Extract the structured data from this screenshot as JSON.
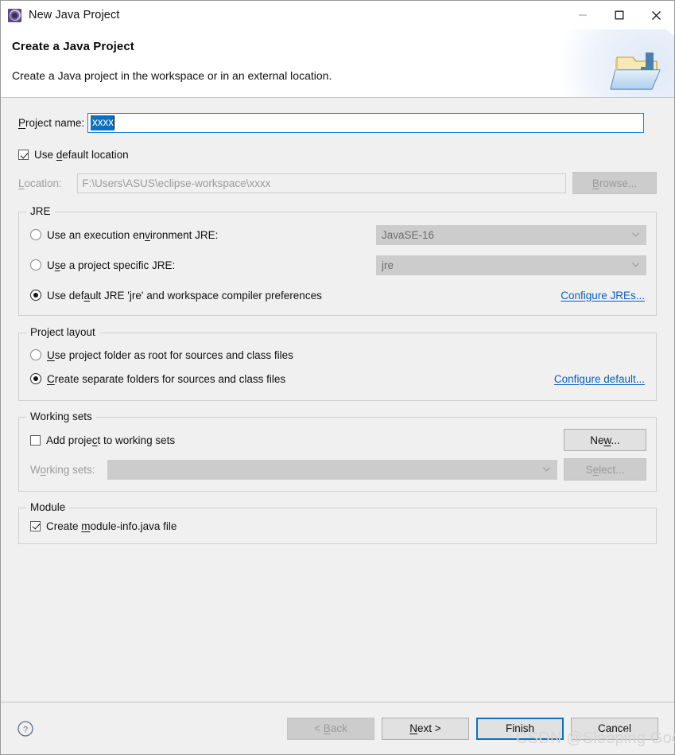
{
  "window": {
    "title": "New Java Project",
    "icon": "java-project-icon",
    "controls": {
      "minimize": "minimize-icon",
      "maximize": "maximize-icon",
      "close": "close-icon"
    }
  },
  "header": {
    "title": "Create a Java Project",
    "description": "Create a Java project in the workspace or in an external location.",
    "banner_icon": "java-project-folder-icon"
  },
  "project": {
    "name_label": "Project name:",
    "name_value": "xxxx",
    "name_selected": true,
    "use_default_location_label": "Use default location",
    "use_default_location_checked": true,
    "location_label": "Location:",
    "location_value": "F:\\Users\\ASUS\\eclipse-workspace\\xxxx",
    "browse_label": "Browse...",
    "browse_enabled": false
  },
  "jre": {
    "legend": "JRE",
    "options": [
      {
        "label_pre": "Use an execution en",
        "label_mn": "v",
        "label_post": "ironment JRE:",
        "selected": false,
        "combo_value": "JavaSE-16",
        "combo_enabled": false
      },
      {
        "label_pre": "U",
        "label_mn": "s",
        "label_post": "e a project specific JRE:",
        "selected": false,
        "combo_value": "jre",
        "combo_enabled": false
      },
      {
        "label_pre": "Use def",
        "label_mn": "a",
        "label_post": "ult JRE 'jre' and workspace compiler preferences",
        "selected": true,
        "combo_value": null,
        "combo_enabled": false
      }
    ],
    "configure_link": "Configure JREs..."
  },
  "layout": {
    "legend": "Project layout",
    "options": [
      {
        "label_pre": "",
        "label_mn": "U",
        "label_post": "se project folder as root for sources and class files",
        "selected": false
      },
      {
        "label_pre": "",
        "label_mn": "C",
        "label_post": "reate separate folders for sources and class files",
        "selected": true
      }
    ],
    "configure_link": "Configure default..."
  },
  "working_sets": {
    "legend": "Working sets",
    "add_label_pre": "Add proje",
    "add_label_mn": "c",
    "add_label_post": "t to working sets",
    "add_checked": false,
    "sets_label_pre": "W",
    "sets_label_mn": "o",
    "sets_label_post": "rking sets:",
    "sets_value": "",
    "sets_enabled": false,
    "new_label_pre": "Ne",
    "new_label_mn": "w",
    "new_label_post": "...",
    "new_enabled": true,
    "select_label_pre": "S",
    "select_label_mn": "e",
    "select_label_post": "lect...",
    "select_enabled": false
  },
  "module": {
    "legend": "Module",
    "create_label_pre": "Create ",
    "create_label_mn": "m",
    "create_label_post": "odule-info.java file",
    "create_checked": true
  },
  "footer": {
    "help_icon": "help-icon",
    "back_pre": "< ",
    "back_mn": "B",
    "back_post": "ack",
    "back_enabled": false,
    "next_pre": "",
    "next_mn": "N",
    "next_post": "ext >",
    "next_enabled": true,
    "finish_label": "Finish",
    "finish_default": true,
    "cancel_label": "Cancel"
  },
  "watermark": "CSDN @Sleeping God",
  "colors": {
    "accent_blue": "#0a72c4",
    "link_blue": "#0a5fbf",
    "dialog_bg": "#f0f0f0",
    "disabled_gray": "#cccccc"
  }
}
